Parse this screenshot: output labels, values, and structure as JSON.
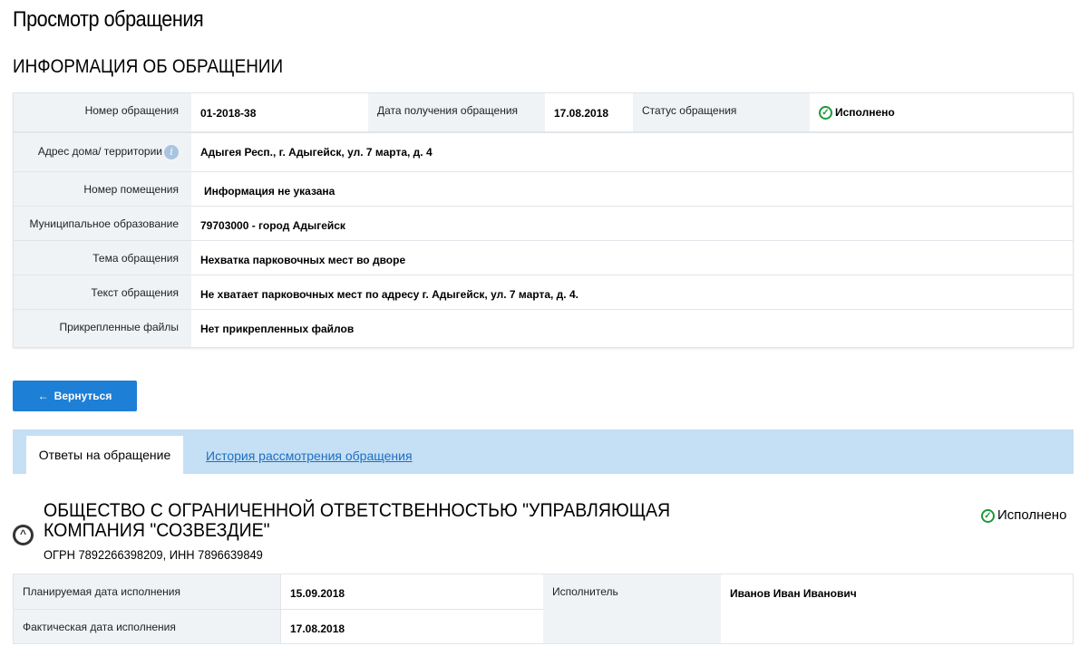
{
  "page_title": "Просмотр обращения",
  "section_title": "ИНФОРМАЦИЯ ОБ ОБРАЩЕНИИ",
  "info": {
    "number_label": "Номер обращения",
    "number": "01-2018-38",
    "date_label": "Дата получения обращения",
    "date": "17.08.2018",
    "status_label": "Статус обращения",
    "status": "Исполнено",
    "rows": [
      {
        "label": "Адрес дома/ территории",
        "value": "Адыгея Респ., г. Адыгейск, ул. 7 марта, д. 4"
      },
      {
        "label": "Номер помещения",
        "value": "Информация не указана"
      },
      {
        "label": "Муниципальное образование",
        "value": "79703000 - город Адыгейск"
      },
      {
        "label": "Тема обращения",
        "value": "Нехватка парковочных мест во дворе"
      },
      {
        "label": "Текст обращения",
        "value": "Не хватает парковочных мест по адресу г. Адыгейск, ул. 7 марта, д. 4."
      },
      {
        "label": "Прикрепленные файлы",
        "value": "Нет прикрепленных файлов"
      }
    ]
  },
  "back_button": "Вернуться",
  "tabs": [
    "Ответы на обращение",
    "История рассмотрения обращения"
  ],
  "response": {
    "org": "ОБЩЕСТВО С ОГРАНИЧЕННОЙ ОТВЕТСТВЕННОСТЬЮ \"УПРАВЛЯЮЩАЯ КОМПАНИЯ \"СОЗВЕЗДИЕ\"",
    "ids": "ОГРН 7892266398209, ИНН 7896639849",
    "status": "Исполнено",
    "planned_label": "Планируемая дата исполнения",
    "planned": "15.09.2018",
    "actual_label": "Фактическая дата исполнения",
    "actual": "17.08.2018",
    "executor_label": "Исполнитель",
    "executor": "Иванов Иван Иванович"
  }
}
